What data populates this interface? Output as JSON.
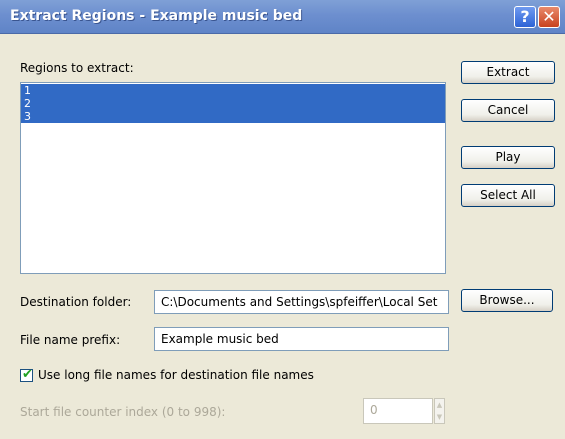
{
  "window": {
    "title": "Extract Regions - Example music bed",
    "help_glyph": "?",
    "close_glyph": "✕"
  },
  "regions": {
    "label": "Regions to extract:",
    "items": [
      "1",
      "2",
      "3"
    ]
  },
  "buttons": {
    "extract": "Extract",
    "cancel": "Cancel",
    "play": "Play",
    "select_all": "Select All",
    "browse": "Browse..."
  },
  "destination": {
    "label": "Destination folder:",
    "value": "C:\\Documents and Settings\\spfeiffer\\Local Set"
  },
  "prefix": {
    "label": "File name prefix:",
    "value": "Example music bed"
  },
  "long_names": {
    "label": "Use long file names for destination file names",
    "checked": true
  },
  "counter": {
    "label": "Start file counter index (0 to 998):",
    "value": "0",
    "disabled": true
  },
  "colors": {
    "selection": "#316ac5",
    "titlebar": "#6d8fcf",
    "dialog_bg": "#ece9d8"
  }
}
